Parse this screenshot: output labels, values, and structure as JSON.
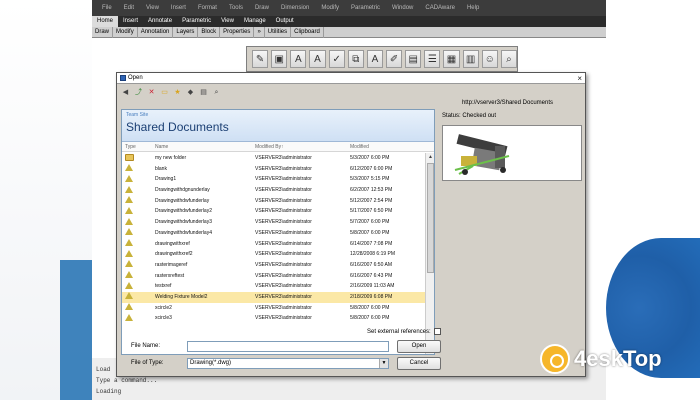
{
  "menubar": [
    "File",
    "Edit",
    "View",
    "Insert",
    "Format",
    "Tools",
    "Draw",
    "Dimension",
    "Modify",
    "Parametric",
    "Window",
    "CADAware",
    "Help"
  ],
  "ribbon_tabs": [
    {
      "label": "Home",
      "active": true
    },
    {
      "label": "Insert"
    },
    {
      "label": "Annotate"
    },
    {
      "label": "Parametric"
    },
    {
      "label": "View"
    },
    {
      "label": "Manage"
    },
    {
      "label": "Output"
    }
  ],
  "ribbon_panels": [
    "Draw",
    "Modify",
    "Annotation",
    "Layers",
    "Block",
    "Properties",
    "»",
    "Utilities",
    "Clipboard"
  ],
  "toolbar_icons": [
    "open-pencil-icon",
    "save-icon",
    "markup-icon",
    "redline-icon",
    "check-out-icon",
    "compare-icon",
    "text-icon",
    "edit-icon",
    "clipboard-icon",
    "properties-icon",
    "grid-icon",
    "table-icon",
    "contact-icon",
    "zoom-icon"
  ],
  "command_line": [
    "Load",
    "Type a command...",
    "Loading"
  ],
  "dialog": {
    "title": "Open",
    "close": "×",
    "toolbar_icons": [
      "back-icon",
      "up-folder-icon",
      "delete-icon",
      "new-folder-icon",
      "favorites-icon",
      "views-icon",
      "details-icon",
      "search-icon"
    ],
    "path": "http://vserver3/Shared Documents",
    "site_label": "Team Site",
    "site_title": "Shared Documents",
    "columns": [
      "Type",
      "Name",
      "Modified By",
      "Modified"
    ],
    "rows": [
      {
        "type": "folder",
        "name": "my new folder",
        "by": "VSERVER3\\administrator",
        "modified": "5/3/2007 6:00 PM"
      },
      {
        "type": "dwg",
        "name": "blank",
        "by": "VSERVER3\\administrator",
        "modified": "6/12/2007 6:00 PM"
      },
      {
        "type": "dwg",
        "name": "Drawing1",
        "by": "VSERVER3\\administrator",
        "modified": "5/3/2007 5:15 PM"
      },
      {
        "type": "dwg",
        "name": "Drawingwithdgnunderlay",
        "by": "VSERVER3\\administrator",
        "modified": "6/2/2007 12:53 PM"
      },
      {
        "type": "dwg",
        "name": "Drawingwithdwfunderlay",
        "by": "VSERVER3\\administrator",
        "modified": "5/12/2007 2:54 PM"
      },
      {
        "type": "dwg",
        "name": "Drawingwithdwfunderlay2",
        "by": "VSERVER3\\administrator",
        "modified": "5/17/2007 6:50 PM"
      },
      {
        "type": "dwg",
        "name": "Drawingwithdwfunderlay3",
        "by": "VSERVER3\\administrator",
        "modified": "5/7/2007 6:00 PM"
      },
      {
        "type": "dwg",
        "name": "Drawingwithdwfunderlay4",
        "by": "VSERVER3\\administrator",
        "modified": "5/8/2007 6:00 PM"
      },
      {
        "type": "dwg",
        "name": "drawingwithxref",
        "by": "VSERVER3\\administrator",
        "modified": "6/14/2007 7:08 PM"
      },
      {
        "type": "dwg",
        "name": "drawingwithxref2",
        "by": "VSERVER3\\administrator",
        "modified": "12/28/2008 6:19 PM"
      },
      {
        "type": "dwg",
        "name": "rasterimageref",
        "by": "VSERVER3\\administrator",
        "modified": "6/16/2007 6:50 AM"
      },
      {
        "type": "dwg",
        "name": "rasterxreftest",
        "by": "VSERVER3\\administrator",
        "modified": "6/16/2007 6:43 PM"
      },
      {
        "type": "dwg",
        "name": "testxref",
        "by": "VSERVER3\\administrator",
        "modified": "2/16/2009 11:03 AM"
      },
      {
        "type": "dwg",
        "name": "Welding Fixture Model2",
        "by": "VSERVER3\\administrator",
        "modified": "2/18/2009 6:08 PM",
        "selected": true
      },
      {
        "type": "dwg",
        "name": "xcircle2",
        "by": "VSERVER3\\administrator",
        "modified": "5/8/2007 6:00 PM"
      },
      {
        "type": "dwg",
        "name": "xcircle3",
        "by": "VSERVER3\\administrator",
        "modified": "5/8/2007 6:00 PM"
      }
    ],
    "status": "Status: Checked out",
    "external_refs_label": "Set external references:",
    "file_name_label": "File Name:",
    "file_name_value": "",
    "file_type_label": "File of Type:",
    "file_type_value": "Drawing(*.dwg)",
    "open_button": "Open",
    "cancel_button": "Cancel"
  },
  "watermark": "4eskTop",
  "colors": {
    "selection": "#fbe8a6",
    "site_title": "#1b3f73",
    "app_dark": "#2b2b2b"
  }
}
